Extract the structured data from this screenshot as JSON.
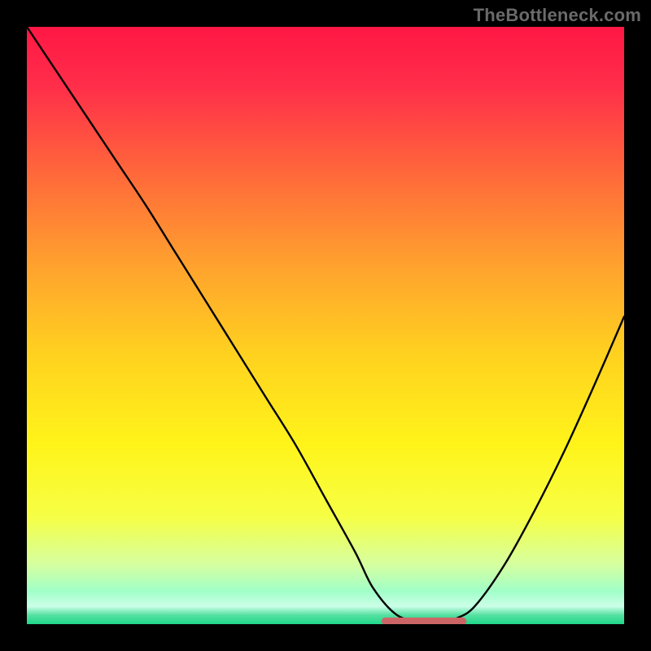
{
  "watermark": "TheBottleneck.com",
  "colors": {
    "frame": "#000000",
    "curve": "#000000",
    "floor_marker": "#cc6666",
    "gradient_stops": [
      {
        "offset": 0.0,
        "color": "#ff1744"
      },
      {
        "offset": 0.1,
        "color": "#ff2e4a"
      },
      {
        "offset": 0.25,
        "color": "#ff6a3a"
      },
      {
        "offset": 0.4,
        "color": "#ffa22e"
      },
      {
        "offset": 0.55,
        "color": "#ffd21f"
      },
      {
        "offset": 0.7,
        "color": "#fff41a"
      },
      {
        "offset": 0.82,
        "color": "#f6ff45"
      },
      {
        "offset": 0.9,
        "color": "#d6ffa0"
      },
      {
        "offset": 0.945,
        "color": "#a0ffc8"
      },
      {
        "offset": 0.97,
        "color": "#ccffe8"
      },
      {
        "offset": 0.985,
        "color": "#55e0a0"
      },
      {
        "offset": 1.0,
        "color": "#1fd88a"
      }
    ]
  },
  "chart_data": {
    "type": "line",
    "title": "",
    "xlabel": "",
    "ylabel": "",
    "xlim": [
      0,
      100
    ],
    "ylim": [
      0,
      100
    ],
    "x": [
      0,
      5,
      10,
      15,
      20,
      25,
      30,
      35,
      40,
      45,
      50,
      55,
      58,
      62,
      66,
      70,
      72,
      75,
      80,
      85,
      90,
      95,
      100
    ],
    "values": [
      100,
      92.5,
      85,
      77.5,
      70,
      62,
      54,
      46,
      38,
      30,
      21,
      12,
      6,
      1.5,
      0.5,
      0.5,
      1,
      3,
      10,
      19,
      29,
      40,
      51.5
    ],
    "floor_segment": {
      "x_start": 60,
      "x_end": 73,
      "y": 0.5
    },
    "notes": "V-shaped bottleneck curve; minimum (green zone) around x≈63–70. Left arm reaches 100 at x=0; right arm reaches ~52 at x=100."
  }
}
